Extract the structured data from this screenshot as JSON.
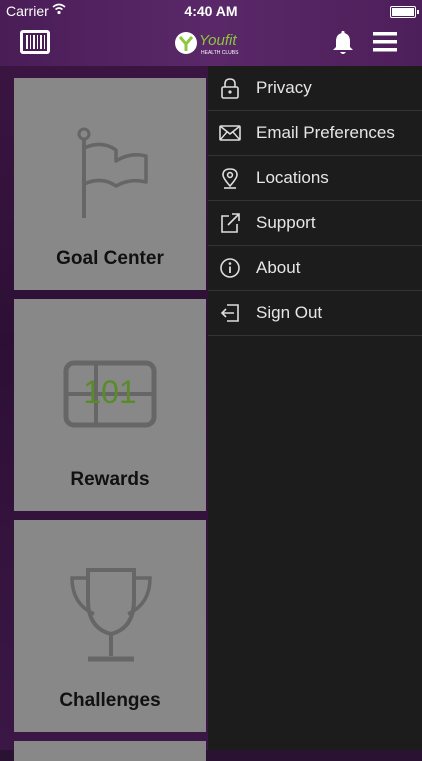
{
  "status_bar": {
    "carrier": "Carrier",
    "time": "4:40 AM"
  },
  "header": {
    "logo_text": "Youfit",
    "logo_subtext": "HEALTH CLUBS",
    "icons": [
      "barcode-icon",
      "bell-icon",
      "hamburger-menu-icon"
    ]
  },
  "cards": [
    {
      "label": "Goal Center",
      "icon": "flag-icon"
    },
    {
      "label": "Rewards",
      "icon": "ticket-icon",
      "icon_text": "101"
    },
    {
      "label": "Challenges",
      "icon": "trophy-icon"
    }
  ],
  "drawer": {
    "items": [
      {
        "label": "Privacy",
        "icon": "lock-icon"
      },
      {
        "label": "Email Preferences",
        "icon": "envelope-icon"
      },
      {
        "label": "Locations",
        "icon": "map-pin-icon"
      },
      {
        "label": "Support",
        "icon": "external-link-icon"
      },
      {
        "label": "About",
        "icon": "info-icon"
      },
      {
        "label": "Sign Out",
        "icon": "sign-out-icon"
      }
    ]
  },
  "colors": {
    "header_purple": "#4a1d57",
    "drawer_bg": "#1d1c1d",
    "card_gray": "#888888",
    "logo_green": "#8dc63f",
    "ticket_text_green": "#5a8a2a"
  }
}
